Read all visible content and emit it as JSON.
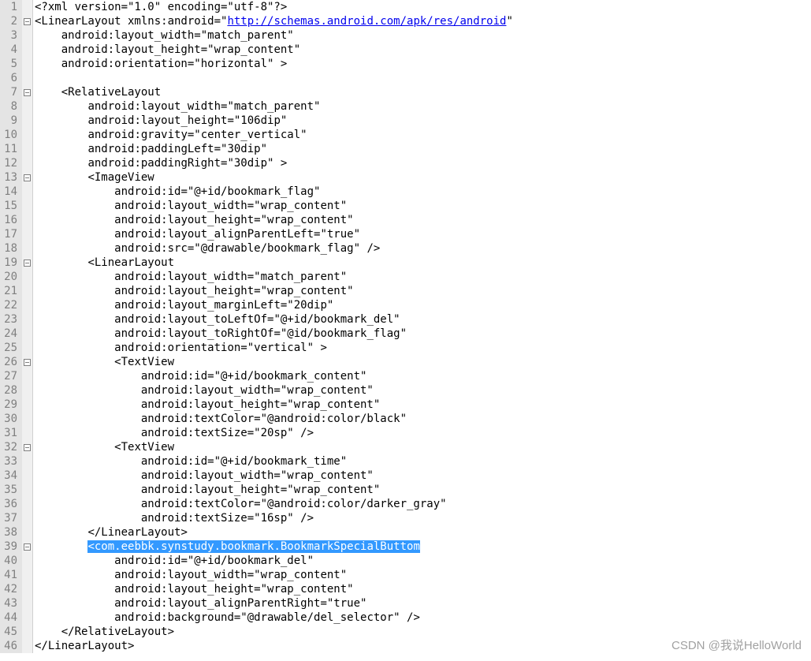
{
  "watermark": "CSDN @我说HelloWorld",
  "fold_markers": [
    2,
    7,
    13,
    19,
    26,
    32,
    39
  ],
  "lines": [
    {
      "n": 1,
      "indent": 0,
      "segs": [
        {
          "t": "<?xml version=\"1.0\" encoding=\"utf-8\"?>"
        }
      ]
    },
    {
      "n": 2,
      "indent": 0,
      "segs": [
        {
          "t": "<LinearLayout xmlns:android=\""
        },
        {
          "t": "http://schemas.android.com/apk/res/android",
          "cls": "link"
        },
        {
          "t": "\""
        }
      ]
    },
    {
      "n": 3,
      "indent": 1,
      "segs": [
        {
          "t": "android:layout_width=\"match_parent\""
        }
      ]
    },
    {
      "n": 4,
      "indent": 1,
      "segs": [
        {
          "t": "android:layout_height=\"wrap_content\""
        }
      ]
    },
    {
      "n": 5,
      "indent": 1,
      "segs": [
        {
          "t": "android:orientation=\"horizontal\" >"
        }
      ]
    },
    {
      "n": 6,
      "indent": 0,
      "segs": [
        {
          "t": ""
        }
      ]
    },
    {
      "n": 7,
      "indent": 1,
      "segs": [
        {
          "t": "<RelativeLayout"
        }
      ]
    },
    {
      "n": 8,
      "indent": 2,
      "segs": [
        {
          "t": "android:layout_width=\"match_parent\""
        }
      ]
    },
    {
      "n": 9,
      "indent": 2,
      "segs": [
        {
          "t": "android:layout_height=\"106dip\""
        }
      ]
    },
    {
      "n": 10,
      "indent": 2,
      "segs": [
        {
          "t": "android:gravity=\"center_vertical\""
        }
      ]
    },
    {
      "n": 11,
      "indent": 2,
      "segs": [
        {
          "t": "android:paddingLeft=\"30dip\""
        }
      ]
    },
    {
      "n": 12,
      "indent": 2,
      "segs": [
        {
          "t": "android:paddingRight=\"30dip\" >"
        }
      ]
    },
    {
      "n": 13,
      "indent": 2,
      "segs": [
        {
          "t": "<ImageView"
        }
      ]
    },
    {
      "n": 14,
      "indent": 3,
      "segs": [
        {
          "t": "android:id=\"@+id/bookmark_flag\""
        }
      ]
    },
    {
      "n": 15,
      "indent": 3,
      "segs": [
        {
          "t": "android:layout_width=\"wrap_content\""
        }
      ]
    },
    {
      "n": 16,
      "indent": 3,
      "segs": [
        {
          "t": "android:layout_height=\"wrap_content\""
        }
      ]
    },
    {
      "n": 17,
      "indent": 3,
      "segs": [
        {
          "t": "android:layout_alignParentLeft=\"true\""
        }
      ]
    },
    {
      "n": 18,
      "indent": 3,
      "segs": [
        {
          "t": "android:src=\"@drawable/bookmark_flag\" />"
        }
      ]
    },
    {
      "n": 19,
      "indent": 2,
      "segs": [
        {
          "t": "<LinearLayout"
        }
      ]
    },
    {
      "n": 20,
      "indent": 3,
      "segs": [
        {
          "t": "android:layout_width=\"match_parent\""
        }
      ]
    },
    {
      "n": 21,
      "indent": 3,
      "segs": [
        {
          "t": "android:layout_height=\"wrap_content\""
        }
      ]
    },
    {
      "n": 22,
      "indent": 3,
      "segs": [
        {
          "t": "android:layout_marginLeft=\"20dip\""
        }
      ]
    },
    {
      "n": 23,
      "indent": 3,
      "segs": [
        {
          "t": "android:layout_toLeftOf=\"@+id/bookmark_del\""
        }
      ]
    },
    {
      "n": 24,
      "indent": 3,
      "segs": [
        {
          "t": "android:layout_toRightOf=\"@id/bookmark_flag\""
        }
      ]
    },
    {
      "n": 25,
      "indent": 3,
      "segs": [
        {
          "t": "android:orientation=\"vertical\" >"
        }
      ]
    },
    {
      "n": 26,
      "indent": 3,
      "segs": [
        {
          "t": "<TextView"
        }
      ]
    },
    {
      "n": 27,
      "indent": 4,
      "segs": [
        {
          "t": "android:id=\"@+id/bookmark_content\""
        }
      ]
    },
    {
      "n": 28,
      "indent": 4,
      "segs": [
        {
          "t": "android:layout_width=\"wrap_content\""
        }
      ]
    },
    {
      "n": 29,
      "indent": 4,
      "segs": [
        {
          "t": "android:layout_height=\"wrap_content\""
        }
      ]
    },
    {
      "n": 30,
      "indent": 4,
      "segs": [
        {
          "t": "android:textColor=\"@android:color/black\""
        }
      ]
    },
    {
      "n": 31,
      "indent": 4,
      "segs": [
        {
          "t": "android:textSize=\"20sp\" />"
        }
      ]
    },
    {
      "n": 32,
      "indent": 3,
      "segs": [
        {
          "t": "<TextView"
        }
      ]
    },
    {
      "n": 33,
      "indent": 4,
      "segs": [
        {
          "t": "android:id=\"@+id/bookmark_time\""
        }
      ]
    },
    {
      "n": 34,
      "indent": 4,
      "segs": [
        {
          "t": "android:layout_width=\"wrap_content\""
        }
      ]
    },
    {
      "n": 35,
      "indent": 4,
      "segs": [
        {
          "t": "android:layout_height=\"wrap_content\""
        }
      ]
    },
    {
      "n": 36,
      "indent": 4,
      "segs": [
        {
          "t": "android:textColor=\"@android:color/darker_gray\""
        }
      ]
    },
    {
      "n": 37,
      "indent": 4,
      "segs": [
        {
          "t": "android:textSize=\"16sp\" />"
        }
      ]
    },
    {
      "n": 38,
      "indent": 2,
      "segs": [
        {
          "t": "</LinearLayout>"
        }
      ]
    },
    {
      "n": 39,
      "indent": 2,
      "segs": [
        {
          "t": "<com.eebbk.synstudy.bookmark.BookmarkSpecialButtom",
          "cls": "sel"
        }
      ]
    },
    {
      "n": 40,
      "indent": 3,
      "segs": [
        {
          "t": "android:id=\"@+id/bookmark_del\""
        }
      ]
    },
    {
      "n": 41,
      "indent": 3,
      "segs": [
        {
          "t": "android:layout_width=\"wrap_content\""
        }
      ]
    },
    {
      "n": 42,
      "indent": 3,
      "segs": [
        {
          "t": "android:layout_height=\"wrap_content\""
        }
      ]
    },
    {
      "n": 43,
      "indent": 3,
      "segs": [
        {
          "t": "android:layout_alignParentRight=\"true\""
        }
      ]
    },
    {
      "n": 44,
      "indent": 3,
      "segs": [
        {
          "t": "android:background=\"@drawable/del_selector\" />"
        }
      ]
    },
    {
      "n": 45,
      "indent": 1,
      "segs": [
        {
          "t": "</RelativeLayout>"
        }
      ]
    },
    {
      "n": 46,
      "indent": 0,
      "segs": [
        {
          "t": "</LinearLayout>"
        }
      ]
    }
  ]
}
